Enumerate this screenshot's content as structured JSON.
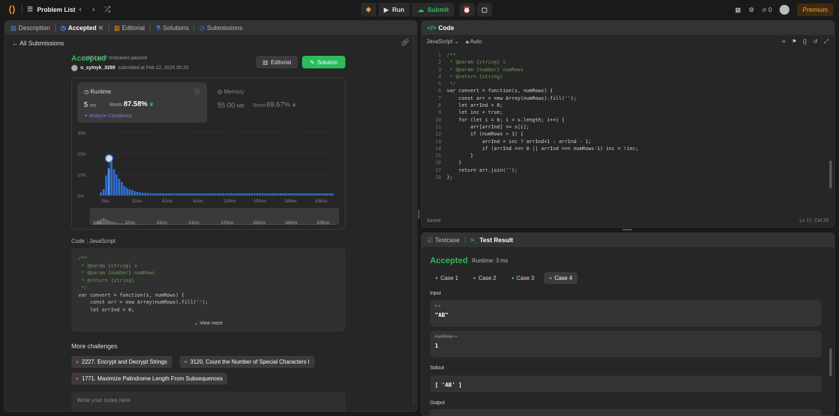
{
  "topbar": {
    "problem_list": "Problem List",
    "run": "Run",
    "submit": "Submit",
    "streak": "0",
    "premium": "Premium"
  },
  "left_tabs": [
    "Description",
    "Accepted",
    "Editorial",
    "Solutions",
    "Submissions"
  ],
  "back_label": "All Submissions",
  "submission": {
    "status": "Accepted",
    "passed": "1157 / 1157 testcases passed",
    "user": "o_sytnyk_3289",
    "submitted_at": "submitted at Feb 12, 2025 00:20",
    "editorial_btn": "Editorial",
    "solution_btn": "Solution"
  },
  "runtime": {
    "label": "Runtime",
    "value": "5",
    "unit": "ms",
    "beats_label": "Beats",
    "beats": "87.58%",
    "analyze": "Analyze Complexity"
  },
  "memory": {
    "label": "Memory",
    "value": "55.00",
    "unit": "MB",
    "beats_label": "Beats",
    "beats": "69.67%"
  },
  "chart_data": {
    "type": "bar",
    "ylabels": [
      "30%",
      "20%",
      "10%",
      "0%"
    ],
    "ylim": [
      0,
      30
    ],
    "xlabels": [
      "2ms",
      "32ms",
      "61ms",
      "91ms",
      "120ms",
      "150ms",
      "180ms",
      "209ms"
    ],
    "values": [
      1.5,
      3,
      9.5,
      13,
      16,
      12.5,
      10,
      8,
      6.5,
      4.5,
      3.5,
      3,
      2.5,
      2,
      1.7,
      1.5,
      1.3,
      1.2,
      1.1,
      1.1,
      1,
      1,
      1,
      1,
      1,
      1,
      1,
      1,
      1,
      1,
      1,
      1,
      1,
      1,
      1,
      1,
      1,
      1,
      1,
      1,
      1,
      1,
      1,
      1,
      1,
      1,
      1,
      1,
      1,
      1,
      1,
      1,
      1,
      1,
      1,
      1,
      1,
      1,
      1,
      1,
      1,
      1,
      1,
      1,
      1,
      1,
      1,
      1,
      1,
      1,
      1,
      1,
      1,
      1,
      1,
      1,
      1,
      1,
      1,
      1,
      1,
      1,
      1,
      1,
      1,
      1,
      1,
      1,
      1,
      1
    ],
    "highlight_index": 3,
    "highlight_color": "#4b8ff0",
    "bar_color": "#2f6fd0"
  },
  "code_section": {
    "label": "Code",
    "lang": "JavaScript",
    "view_more": "View more",
    "lines": [
      "/**",
      " * @param {string} s",
      " * @param {number} numRows",
      " * @return {string}",
      " */",
      "var convert = function(s, numRows) {",
      "    const arr = new Array(numRows).fill('');",
      "    let arrInd = 0;"
    ]
  },
  "more_challenges": {
    "title": "More challenges",
    "items": [
      {
        "label": "2227. Encrypt and Decrypt Strings",
        "color": "#ef4743"
      },
      {
        "label": "3120. Count the Number of Special Characters I",
        "color": "#2cbb5d"
      },
      {
        "label": "1771. Maximize Palindrome Length From Subsequences",
        "color": "#ef4743"
      }
    ]
  },
  "notes_placeholder": "Write your notes here",
  "code_panel": {
    "title": "Code",
    "lang": "JavaScript",
    "auto": "Auto",
    "saved": "Saved",
    "cursor": "Ln 17, Col 25",
    "line_numbers": [
      "1",
      "2",
      "3",
      "4",
      "5",
      "6",
      "7",
      "8",
      "9",
      "10",
      "11",
      "12",
      "13",
      "14",
      "15",
      "16",
      "17",
      "18"
    ],
    "lines": [
      "/**",
      " * @param {string} s",
      " * @param {number} numRows",
      " * @return {string}",
      " */",
      "var convert = function(s, numRows) {",
      "    const arr = new Array(numRows).fill('');",
      "    let arrInd = 0;",
      "    let inc = true;",
      "    for (let i = 0; i < s.length; i++) {",
      "        arr[arrInd] += s[i];",
      "        if (numRows > 1) {",
      "            arrInd = inc ? arrInd+1 : arrInd - 1;",
      "            if (arrInd === 0 || arrInd === numRows-1) inc = !inc;",
      "        }",
      "    }",
      "    return arr.join('');",
      "};"
    ]
  },
  "result_panel": {
    "tab_testcase": "Testcase",
    "tab_result": "Test Result",
    "status": "Accepted",
    "runtime": "Runtime: 3 ms",
    "cases": [
      "Case 1",
      "Case 2",
      "Case 3",
      "Case 4"
    ],
    "input_label": "Input",
    "s_label": "s =",
    "s_value": "\"AB\"",
    "numrows_label": "numRows =",
    "numrows_value": "1",
    "stdout_label": "Stdout",
    "stdout_value": "[ 'AB' ]",
    "output_label": "Output"
  }
}
